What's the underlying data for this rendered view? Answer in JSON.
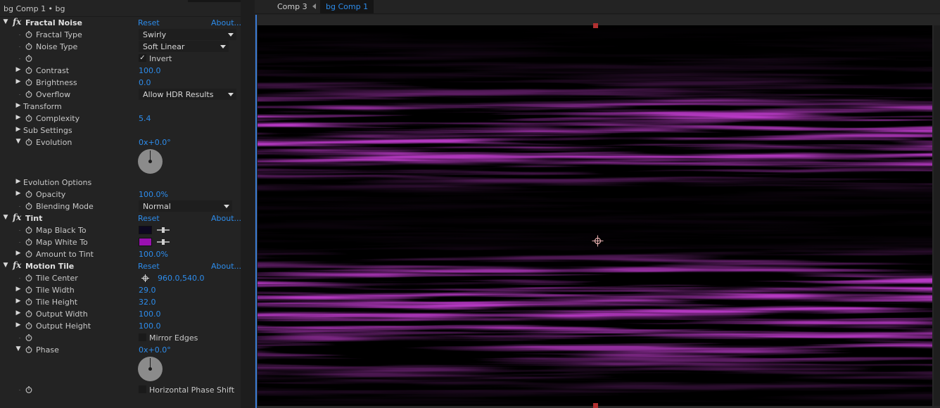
{
  "effect_controls": {
    "header": "bg Comp 1 • bg",
    "effects": {
      "fractal_noise": {
        "name": "Fractal Noise",
        "reset": "Reset",
        "about": "About...",
        "fractal_type": {
          "label": "Fractal Type",
          "value": "Swirly"
        },
        "noise_type": {
          "label": "Noise Type",
          "value": "Soft Linear"
        },
        "invert": {
          "label": "Invert",
          "checked": true
        },
        "contrast": {
          "label": "Contrast",
          "value": "100.0"
        },
        "brightness": {
          "label": "Brightness",
          "value": "0.0"
        },
        "overflow": {
          "label": "Overflow",
          "value": "Allow HDR Results"
        },
        "transform": {
          "label": "Transform"
        },
        "complexity": {
          "label": "Complexity",
          "value": "5.4"
        },
        "sub_settings": {
          "label": "Sub Settings"
        },
        "evolution": {
          "label": "Evolution",
          "value": "0x+0.0°"
        },
        "evolution_options": {
          "label": "Evolution Options"
        },
        "opacity": {
          "label": "Opacity",
          "value": "100.0%"
        },
        "blending_mode": {
          "label": "Blending Mode",
          "value": "Normal"
        }
      },
      "tint": {
        "name": "Tint",
        "reset": "Reset",
        "about": "About...",
        "map_black_to": {
          "label": "Map Black To",
          "color": "#0d0820"
        },
        "map_white_to": {
          "label": "Map White To",
          "color": "#9a10b0"
        },
        "amount_to_tint": {
          "label": "Amount to Tint",
          "value": "100.0%"
        }
      },
      "motion_tile": {
        "name": "Motion Tile",
        "reset": "Reset",
        "about": "About...",
        "tile_center": {
          "label": "Tile Center",
          "value": "960.0,540.0"
        },
        "tile_width": {
          "label": "Tile Width",
          "value": "29.0"
        },
        "tile_height": {
          "label": "Tile Height",
          "value": "32.0"
        },
        "output_width": {
          "label": "Output Width",
          "value": "100.0"
        },
        "output_height": {
          "label": "Output Height",
          "value": "100.0"
        },
        "mirror_edges": {
          "label": "Mirror Edges",
          "checked": false
        },
        "phase": {
          "label": "Phase",
          "value": "0x+0.0°"
        },
        "horizontal_phase_shift": {
          "label": "Horizontal Phase Shift",
          "checked": false
        }
      }
    }
  },
  "composition": {
    "tabs": [
      {
        "label": "Comp 3",
        "active": false
      },
      {
        "label": "bg Comp 1",
        "active": true
      }
    ],
    "accent_color": "#2d8ceb",
    "noise_color": "#9a10b0"
  }
}
